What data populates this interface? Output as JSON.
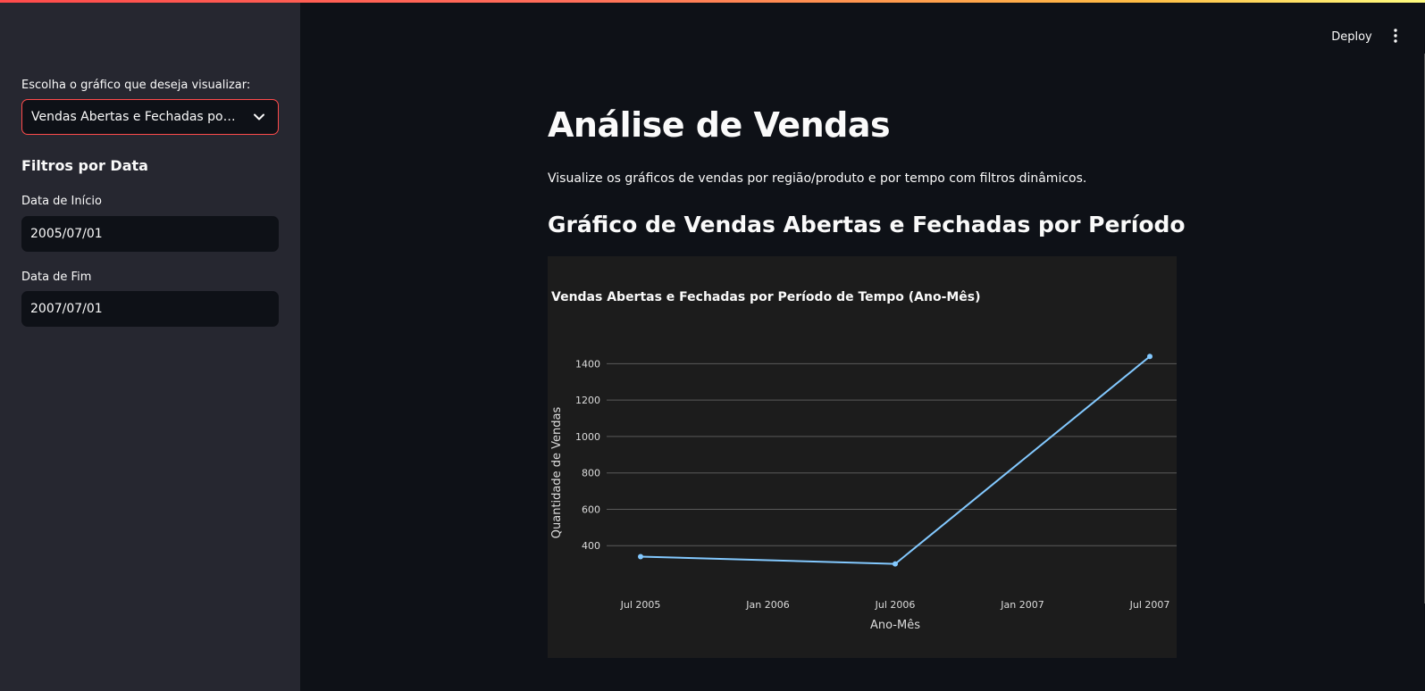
{
  "sidebar": {
    "select_label": "Escolha o gráfico que deseja visualizar:",
    "select_value": "Vendas Abertas e Fechadas por Período",
    "filters_heading": "Filtros por Data",
    "start_label": "Data de Início",
    "start_value": "2005/07/01",
    "end_label": "Data de Fim",
    "end_value": "2007/07/01"
  },
  "header": {
    "deploy_label": "Deploy",
    "menu_icon": "vertical-dots-icon"
  },
  "main": {
    "title": "Análise de Vendas",
    "subtitle": "Visualize os gráficos de vendas por região/produto e por tempo com filtros dinâmicos.",
    "section_title": "Gráfico de Vendas Abertas e Fechadas por Período"
  },
  "colors": {
    "accent": "#ff4b4b",
    "line": "#83c9ff",
    "chart_bg": "#1c1c1c",
    "sidebar_bg": "#262730",
    "page_bg": "#0e1117"
  },
  "chart_data": {
    "type": "line",
    "title": "Vendas Abertas e Fechadas por Período de Tempo (Ano-Mês)",
    "xlabel": "Ano-Mês",
    "ylabel": "Quantidade de Vendas",
    "x": [
      "2005-07",
      "2006-07",
      "2007-07"
    ],
    "values": [
      340,
      300,
      1440
    ],
    "xticks": [
      "Jul 2005",
      "Jan 2006",
      "Jul 2006",
      "Jan 2007",
      "Jul 2007"
    ],
    "xtick_months": [
      "2005-07",
      "2006-01",
      "2006-07",
      "2007-01",
      "2007-07"
    ],
    "yticks": [
      400,
      600,
      800,
      1000,
      1200,
      1400
    ],
    "ylim": [
      200,
      1500
    ],
    "grid": true
  }
}
